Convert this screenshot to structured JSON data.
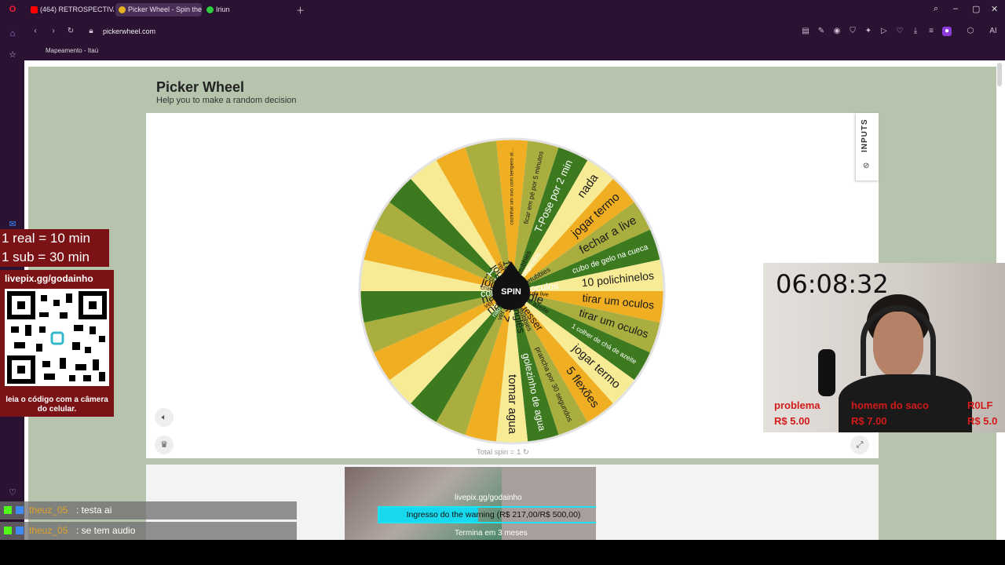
{
  "browser": {
    "tabs": [
      {
        "label": "(464) RETROSPECTIVA 202",
        "icon": "youtube-icon"
      },
      {
        "label": "Picker Wheel - Spin the W",
        "icon": "picker-wheel-icon"
      },
      {
        "label": "Iriun",
        "icon": "green-dot-icon"
      }
    ],
    "url": "pickerwheel.com",
    "bookmark": "Mapeamento - Itaú"
  },
  "page": {
    "title": "Picker Wheel",
    "subtitle": "Help you to make a random decision",
    "inputs_tab": "INPUTS",
    "spin_label": "SPIN",
    "total_spin": "Total spin = 1"
  },
  "wheel": {
    "colors": [
      "#f0ae22",
      "#a9ae3e",
      "#3d7a1f",
      "#f8eb95"
    ],
    "segments": [
      "cozinhar um ovo com tempero al...",
      "ficar em pé por 5 minutos",
      "T-Pose por 2 min",
      "nada",
      "jogar termo",
      "fechar a live",
      "cubo de gelo na cueca",
      "10 polichinelos",
      "tirar um oculos",
      "tirar um oculos",
      "1 colher de chá de azeite",
      "jogar termo",
      "5 flexões",
      "prancha por 30 segundos",
      "golezinho de agua",
      "tomar agua",
      "2 shots",
      "ver um ep de teletubbies",
      "não piscar por 15 segundos",
      "nada",
      "ver um ep de teletubbies",
      "nada",
      "colocar um oculos",
      "chat escolhe o titulo da live",
      "jogar wordle",
      "1 colher de chá de azeite",
      "1 shot",
      "jogar geoguesser",
      "ver um ep de teletubbies",
      "10 min só inglês"
    ]
  },
  "overlay": {
    "rate1": "1 real = 10 min",
    "rate2": "1 sub = 30 min",
    "qr_url": "livepix.gg/godainho",
    "qr_caption": "leia o código com a câmera do celular.",
    "timer": "06:08:32",
    "alerts": [
      {
        "name": "problema",
        "amount": "R$ 5.00"
      },
      {
        "name": "homem do saco",
        "amount": "R$ 7.00"
      },
      {
        "name": "R0LF",
        "amount": "R$ 5.0"
      }
    ],
    "chat": [
      {
        "user": "theuz_05",
        "message": ": testa ai"
      },
      {
        "user": "theuz_05",
        "message": ": se tem audio"
      }
    ],
    "promo_top": "livepix.gg/godainho",
    "promo_goal": "Ingresso do the warning (R$ 217,00/R$ 500,00)",
    "promo_progress": 0.434,
    "promo_ends": "Termina em 3 meses"
  }
}
